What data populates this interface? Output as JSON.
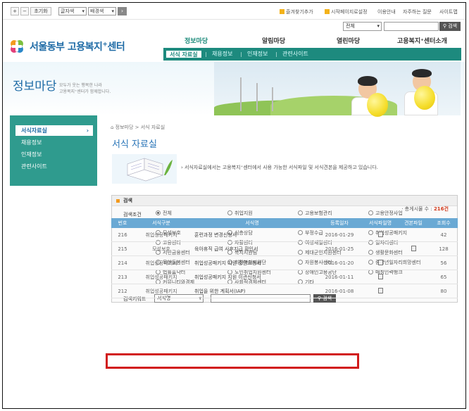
{
  "topbar": {
    "zoom_in": "+",
    "zoom_out": "−",
    "zoom_reset": "초기화",
    "font_select": "글자색",
    "bg_select": "배경색",
    "go": "›",
    "favorites": "즐겨찾기추가",
    "homepage": "시작페이지로설정",
    "usage": "이용안내",
    "faq": "자주하는 질문",
    "sitemap": "사이트맵"
  },
  "search": {
    "scope": "전체",
    "button": "검색"
  },
  "logo": {
    "text": "서울동부 고용복지",
    "sup": "+",
    "suffix": "센터"
  },
  "gnb": [
    {
      "label": "정보마당",
      "active": true
    },
    {
      "label": "알림마당",
      "active": false
    },
    {
      "label": "열린마당",
      "active": false
    },
    {
      "label": "고용복지⁺센터소개",
      "active": false
    }
  ],
  "subnav": [
    {
      "label": "서식 자료실",
      "active": true
    },
    {
      "label": "채용정보",
      "active": false
    },
    {
      "label": "인재정보",
      "active": false
    },
    {
      "label": "관련사이트",
      "active": false
    }
  ],
  "banner": {
    "title": "정보마당",
    "sub1": "모두가 웃는 행복한 나라",
    "sub2": "고용복지⁺센터가 함께합니다."
  },
  "lnb": [
    {
      "label": "서식자료실",
      "active": true
    },
    {
      "label": "채용정보",
      "active": false
    },
    {
      "label": "인재정보",
      "active": false
    },
    {
      "label": "관련사이트",
      "active": false
    }
  ],
  "breadcrumb": "⌂ 정보마당 > 서식 자료실",
  "page_title": "서식 자료실",
  "intro": "› 서식자료실에서는 고용복지⁺센터에서 사용 가능한 서식파일 및 서식견본을 제공하고 있습니다.",
  "search_box": {
    "title": "검색",
    "condition_label": "검색조건",
    "keyword_label": "검색키워드",
    "keyword_select": "서식명",
    "button": "검색",
    "options": [
      [
        "전체",
        "취업지원",
        "고용보험관리",
        "고용안정사업"
      ],
      [
        "집단직업상담",
        "직업능력개발",
        "외국인채용지원",
        "실업급여"
      ],
      [
        "모성보호",
        "심층상담",
        "부정수급",
        "취업성공패키지"
      ],
      [
        "고용센터",
        "자활센터",
        "여성새일센터",
        "일자리센터"
      ],
      [
        "서민금융센터",
        "복지지원팀",
        "제대군인지원센터",
        "생활문화센터"
      ],
      [
        "무한돌봄센터",
        "희망복지지원단",
        "자원봉사센터",
        "중장년일자리희망센터"
      ],
      [
        "법률홈닥터",
        "노인취업지원센터",
        "장애인고용공단",
        "매칭인력뱅크"
      ],
      [
        "커뮤니티와경제",
        "사회적경제센터",
        "기타",
        ""
      ]
    ]
  },
  "total_text": "· 총게시물 수 :",
  "total_count": "216건",
  "table": {
    "headers": [
      "번호",
      "서식구분",
      "서식명",
      "등록일자",
      "서식파일명",
      "견본파일",
      "조회수"
    ],
    "rows": [
      {
        "no": "216",
        "cat": "취업성공패키지",
        "title": "훈련과정 변경신청서",
        "date": "2016-01-29",
        "file": true,
        "sample": false,
        "views": "42"
      },
      {
        "no": "215",
        "cat": "모성보호",
        "title": "육아휴직 급여 사후지급 확인서",
        "date": "2016-01-25",
        "file": false,
        "sample": true,
        "views": "128"
      },
      {
        "no": "214",
        "cat": "취업성공패키지",
        "title": "취업성공패키지 지원 중단요청서",
        "date": "2016-01-20",
        "file": true,
        "sample": false,
        "views": "56"
      },
      {
        "no": "213",
        "cat": "취업성공패키지",
        "title": "취업성공패키지 지원 이관신청서",
        "date": "2016-01-11",
        "file": true,
        "sample": false,
        "views": "65"
      },
      {
        "no": "212",
        "cat": "취업성공패키지",
        "title": "취업을 위한 계획서(IAP)",
        "date": "2016-01-08",
        "file": true,
        "sample": false,
        "views": "80"
      }
    ]
  },
  "colors": {
    "accent": "#1d8a7e",
    "brand_blue": "#1d6aa5",
    "highlight": "#d11b1b"
  }
}
